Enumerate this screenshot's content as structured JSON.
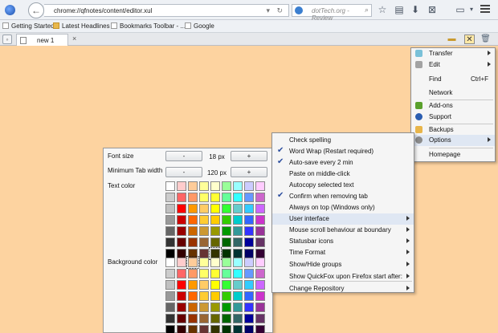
{
  "browser": {
    "url": "chrome://qfnotes/content/editor.xul",
    "search_placeholder": "dotTech.org - Review",
    "bookmarks": [
      "Getting Started",
      "Latest Headlines",
      "Bookmarks Toolbar - ...",
      "Google"
    ],
    "tab_label": "new 1"
  },
  "style_panel": {
    "font_size_label": "Font size",
    "font_size_value": "18 px",
    "min_tab_width_label": "Minimum Tab width",
    "min_tab_width_value": "120 px",
    "decrease_label": "-",
    "increase_label": "+",
    "text_color_label": "Text color",
    "background_color_label": "Background color",
    "palette": [
      [
        "#ffffff",
        "#ffcccc",
        "#ffcc99",
        "#ffff99",
        "#ffffcc",
        "#99ff99",
        "#99ffff",
        "#ccccff",
        "#ffccff"
      ],
      [
        "#cccccc",
        "#ff6666",
        "#ff9966",
        "#ffff66",
        "#ffff33",
        "#66ff99",
        "#33ffff",
        "#6699ff",
        "#cc66cc"
      ],
      [
        "#c0c0c0",
        "#ff0000",
        "#ff9900",
        "#ffcc66",
        "#ffff00",
        "#33ff33",
        "#66cccc",
        "#33ccff",
        "#cc66ff"
      ],
      [
        "#999999",
        "#cc0000",
        "#ff6600",
        "#ffcc33",
        "#ffcc00",
        "#33cc00",
        "#00cccc",
        "#3366ff",
        "#cc33cc"
      ],
      [
        "#666666",
        "#990000",
        "#cc6600",
        "#cc9933",
        "#999900",
        "#009900",
        "#339999",
        "#3333ff",
        "#993399"
      ],
      [
        "#333333",
        "#660000",
        "#993300",
        "#996633",
        "#666600",
        "#006600",
        "#336666",
        "#000099",
        "#663366"
      ],
      [
        "#000000",
        "#330000",
        "#663300",
        "#663333",
        "#333300",
        "#003300",
        "#003333",
        "#000066",
        "#330033"
      ]
    ]
  },
  "options_menu": {
    "items": [
      {
        "label": "Check spelling",
        "checked": false,
        "submenu": false
      },
      {
        "label": "Word Wrap (Restart required)",
        "checked": true,
        "submenu": false
      },
      {
        "label": "Auto-save every 2 min",
        "checked": true,
        "submenu": false
      },
      {
        "label": "Paste on middle-click",
        "checked": false,
        "submenu": false
      },
      {
        "label": "Autocopy selected text",
        "checked": false,
        "submenu": false
      },
      {
        "label": "Confirm when removing tab",
        "checked": true,
        "submenu": false
      },
      {
        "label": "Always on top (Windows only)",
        "checked": false,
        "submenu": false
      },
      {
        "label": "User interface",
        "checked": false,
        "submenu": true,
        "highlighted": true
      },
      {
        "label": "Mouse scroll behaviour at boundary",
        "checked": false,
        "submenu": true
      },
      {
        "label": "Statusbar icons",
        "checked": false,
        "submenu": true
      },
      {
        "label": "Time Format",
        "checked": false,
        "submenu": true
      },
      {
        "label": "Show/Hide groups",
        "checked": false,
        "submenu": true
      },
      {
        "label": "Show QuickFox upon Firefox start after:",
        "checked": false,
        "submenu": true
      },
      {
        "label": "Change Repository",
        "checked": false,
        "submenu": true
      }
    ]
  },
  "main_menu": {
    "transfer": "Transfer",
    "edit": "Edit",
    "find": "Find",
    "find_shortcut": "Ctrl+F",
    "network": "Network",
    "addons": "Add-ons",
    "support": "Support",
    "backups": "Backups",
    "options": "Options",
    "homepage": "Homepage"
  },
  "colors": {
    "content_bg": "#fdd3a0",
    "check": "#2b4d9e",
    "highlight": "#dfe7f3"
  }
}
